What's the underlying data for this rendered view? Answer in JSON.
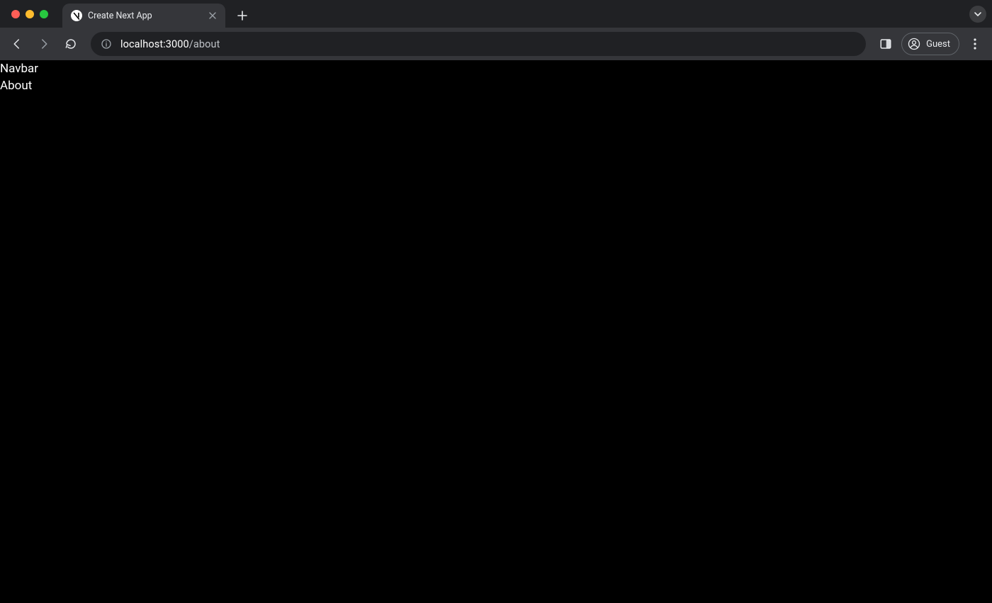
{
  "browser": {
    "tab": {
      "title": "Create Next App"
    },
    "address": {
      "host": "localhost:3000",
      "path": "/about"
    },
    "profile": {
      "label": "Guest"
    }
  },
  "page": {
    "lines": {
      "navbar": "Navbar",
      "about": "About"
    }
  }
}
